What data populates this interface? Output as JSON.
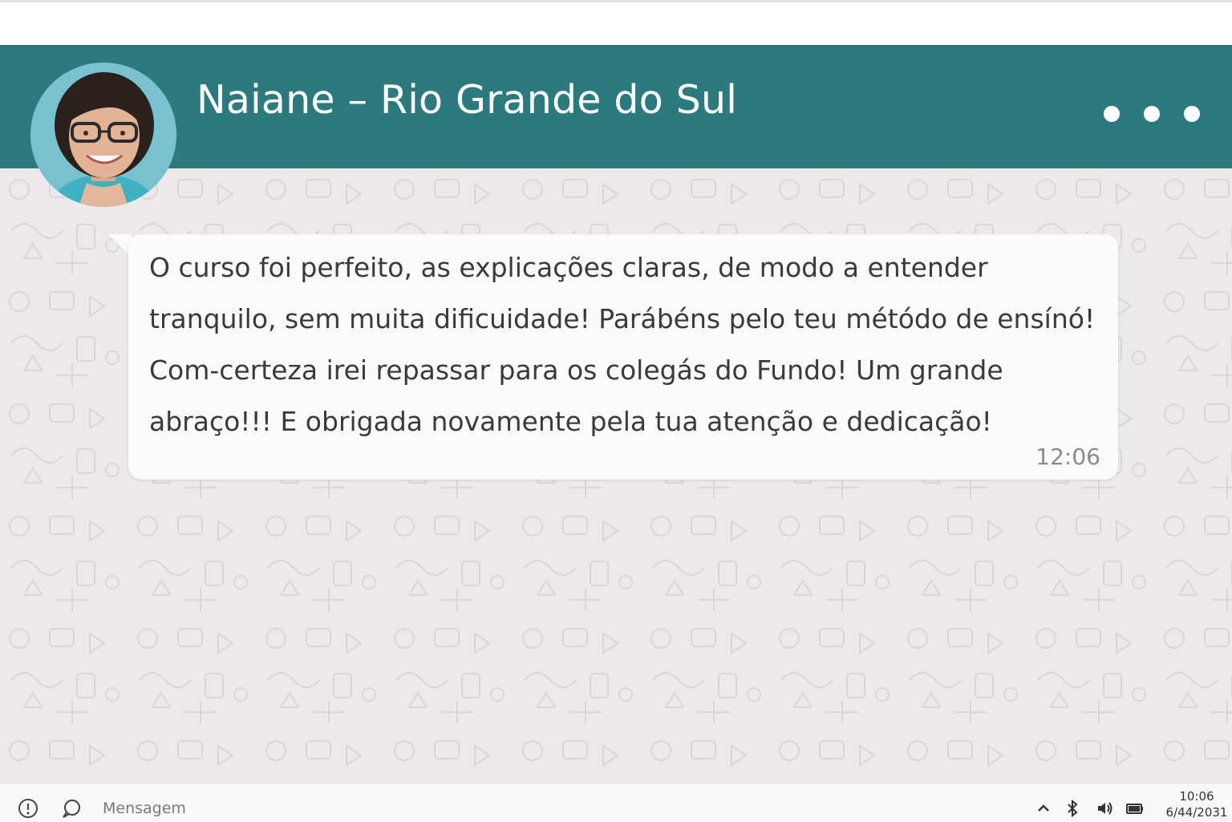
{
  "chat": {
    "contact_name": "Naiane – Rio Grande do Sul",
    "avatar_icon": "contact-photo",
    "menu_icon": "more-options-icon",
    "header_color": "#2c7a7e"
  },
  "message": {
    "lines": [
      "O curso foi perfeito, as explicações claras, de modo a entender",
      "tranquilo, sem muita dificuidade! Parábéns pelo teu métódo de ensínó!",
      "Com-certeza irei repassar para os colegás do Fundo! Um grande",
      "abraço!!! E obrigada novamente pela tua atenção e dedicação!"
    ],
    "time": "12:06"
  },
  "composer": {
    "placeholder": "Mensagem",
    "info_icon": "info-icon",
    "chat_icon": "chat-bubble-icon"
  },
  "taskbar": {
    "tray_icons": [
      "chevron-up-icon",
      "bluetooth-icon",
      "volume-icon",
      "battery-icon"
    ],
    "clock_time": "10:06",
    "clock_date": "6/44/2031"
  }
}
